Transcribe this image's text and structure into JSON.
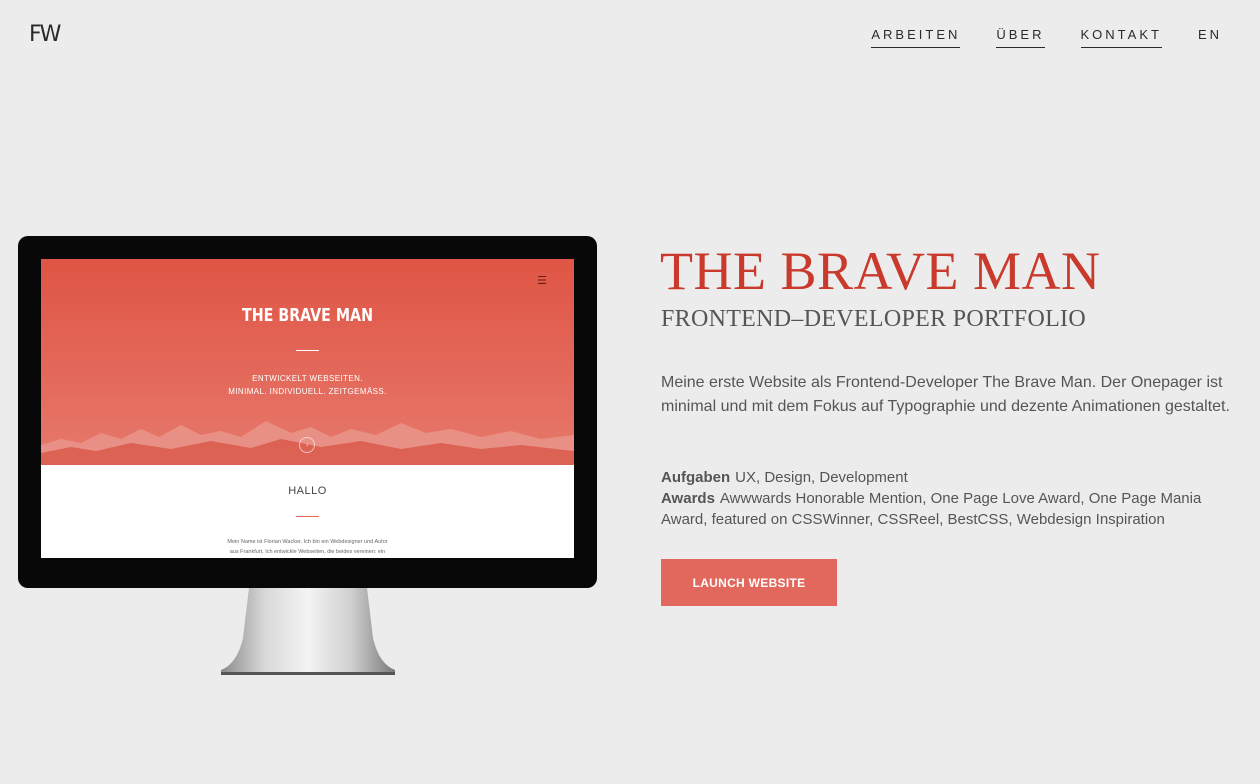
{
  "header": {
    "logo": "FW",
    "nav": [
      {
        "label": "ARBEITEN"
      },
      {
        "label": "ÜBER"
      },
      {
        "label": "KONTAKT"
      },
      {
        "label": "EN"
      }
    ]
  },
  "preview": {
    "title": "THE BRAVE MAN",
    "subtitle_line1": "ENTWICKELT WEBSEITEN.",
    "subtitle_line2": "MINIMAL. INDIVIDUELL. ZEITGEMÄSS.",
    "section_heading": "HALLO",
    "body_line1": "Mein Name ist Florian Wacker. Ich bin ein Webdesigner und Autor",
    "body_line2": "aus Frankfurt. Ich entwickle Webseiten, die beides vereinen: ein",
    "menu_icon": "hamburger-icon",
    "scroll_icon": "scroll-down-icon"
  },
  "project": {
    "title": "THE BRAVE MAN",
    "subtitle": "FRONTEND–DEVELOPER PORTFOLIO",
    "description": "Meine erste Website als Frontend-Developer The Brave Man. Der Onepager ist minimal und mit dem Fokus auf Typographie und dezente Animationen gestaltet.",
    "tasks_label": "Aufgaben",
    "tasks_value": "UX, Design, Development",
    "awards_label": "Awards",
    "awards_value": "Awwwards Honorable Mention, One Page Love Award, One Page Mania Award, featured on CSSWinner, CSSReel, BestCSS, Webdesign Inspiration",
    "launch_label": "LAUNCH WEBSITE"
  },
  "colors": {
    "background": "#ececec",
    "accent": "#c9392c",
    "button": "#e2685d",
    "hero": "#df5545"
  }
}
